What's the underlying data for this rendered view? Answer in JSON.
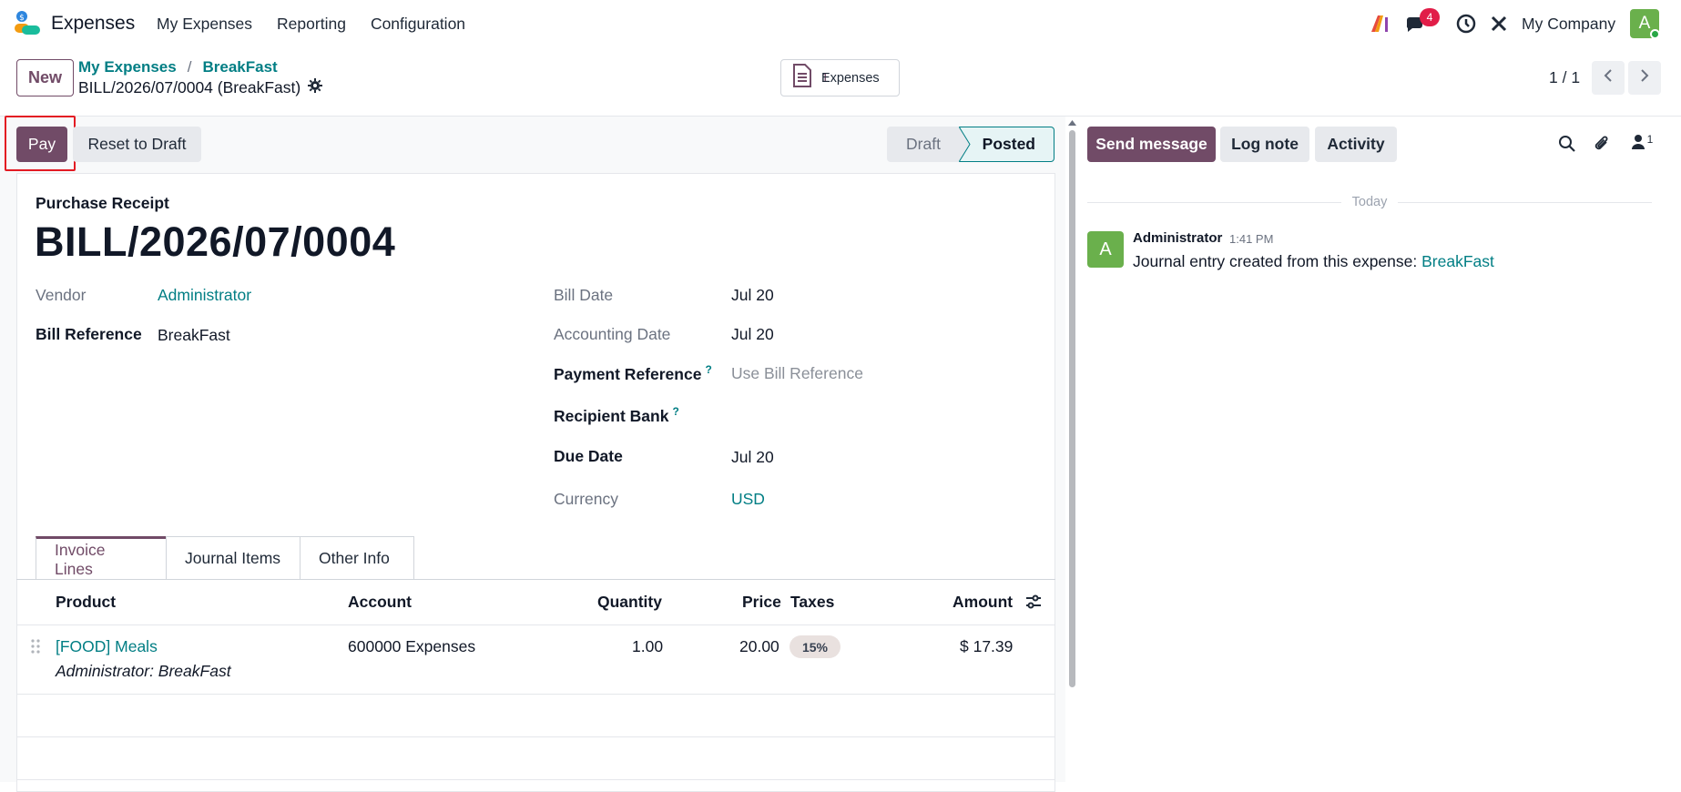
{
  "navbar": {
    "app_name": "Expenses",
    "menu": [
      "My Expenses",
      "Reporting",
      "Configuration"
    ],
    "messages_count": "4",
    "company": "My Company",
    "user_initial": "A",
    "icons": [
      "ai-icon",
      "chat-icon",
      "clock-icon",
      "tools-icon"
    ]
  },
  "control_panel": {
    "new_label": "New",
    "breadcrumb": [
      "My Expenses",
      "BreakFast"
    ],
    "record_title": "BILL/2026/07/0004 (BreakFast)",
    "smart_button": {
      "label": "Expenses",
      "count": "1"
    },
    "pager": "1 / 1"
  },
  "statusbar": {
    "pay_label": "Pay",
    "reset_label": "Reset to Draft",
    "stages": [
      "Draft",
      "Posted"
    ],
    "current_stage": "Posted"
  },
  "form": {
    "doc_type": "Purchase Receipt",
    "doc_name": "BILL/2026/07/0004",
    "left": {
      "vendor_label": "Vendor",
      "vendor_value": "Administrator",
      "bill_ref_label": "Bill Reference",
      "bill_ref_value": "BreakFast"
    },
    "right": {
      "bill_date_label": "Bill Date",
      "bill_date_value": "Jul 20",
      "acc_date_label": "Accounting Date",
      "acc_date_value": "Jul 20",
      "pay_ref_label": "Payment Reference",
      "pay_ref_placeholder": "Use Bill Reference",
      "recipient_label": "Recipient Bank",
      "due_date_label": "Due Date",
      "due_date_value": "Jul 20",
      "currency_label": "Currency",
      "currency_value": "USD",
      "help_mark": "?"
    },
    "tabs": [
      "Invoice Lines",
      "Journal Items",
      "Other Info"
    ],
    "table": {
      "headers": [
        "Product",
        "Account",
        "Quantity",
        "Price",
        "Taxes",
        "Amount"
      ],
      "rows": [
        {
          "product": "[FOOD] Meals",
          "description": "Administrator: BreakFast",
          "account": "600000 Expenses",
          "quantity": "1.00",
          "price": "20.00",
          "tax": "15%",
          "amount": "$ 17.39"
        }
      ]
    }
  },
  "chatter": {
    "send_label": "Send message",
    "log_label": "Log note",
    "activity_label": "Activity",
    "followers_count": "1",
    "date_separator": "Today",
    "message": {
      "author": "Administrator",
      "time": "1:41 PM",
      "author_initial": "A",
      "text": "Journal entry created from this expense: ",
      "link": "BreakFast"
    }
  },
  "colors": {
    "primary": "#714b67",
    "link": "#017e84",
    "avatar": "#6ab04c",
    "badge": "#e11d48"
  }
}
